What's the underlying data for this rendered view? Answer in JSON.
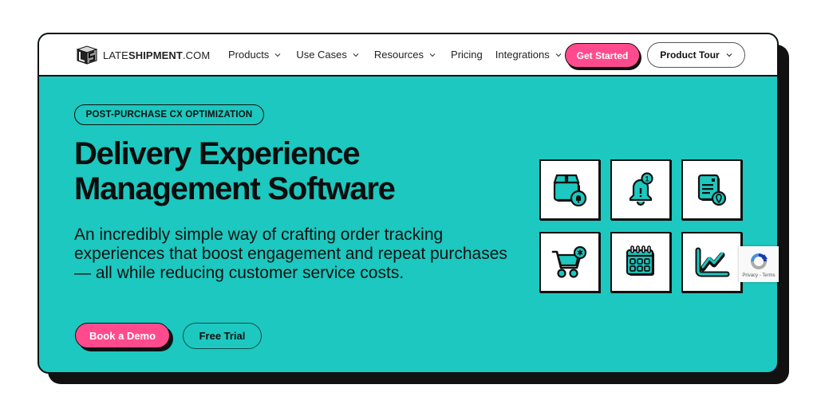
{
  "header": {
    "logo": {
      "prefix": "LATE",
      "bold": "SHIPMENT",
      "suffix": ".COM",
      "icon": "ls-cube-logo"
    },
    "nav": [
      {
        "label": "Products",
        "has_dropdown": true
      },
      {
        "label": "Use Cases",
        "has_dropdown": true
      },
      {
        "label": "Resources",
        "has_dropdown": true
      },
      {
        "label": "Pricing",
        "has_dropdown": false
      },
      {
        "label": "Integrations",
        "has_dropdown": true
      }
    ],
    "get_started_label": "Get Started",
    "product_tour_label": "Product Tour"
  },
  "hero": {
    "pill_label": "POST-PURCHASE CX OPTIMIZATION",
    "headline_line1": "Delivery Experience",
    "headline_line2": "Management Software",
    "subheadline": "An incredibly simple way of crafting order tracking experiences that boost engagement and repeat purchases — all while reducing customer service costs.",
    "book_demo_label": "Book a Demo",
    "free_trial_label": "Free Trial"
  },
  "feature_tiles": [
    {
      "icon": "package-alert-icon"
    },
    {
      "icon": "bell-notification-icon",
      "badge": "1"
    },
    {
      "icon": "document-location-icon"
    },
    {
      "icon": "shopping-cart-icon"
    },
    {
      "icon": "calendar-icon"
    },
    {
      "icon": "line-chart-icon"
    }
  ],
  "recaptcha": {
    "text": "Privacy - Terms"
  },
  "colors": {
    "teal": "#1cc8bf",
    "pink": "#ff4b8d",
    "dark": "#111111",
    "chat_blue": "#5b9cff"
  }
}
